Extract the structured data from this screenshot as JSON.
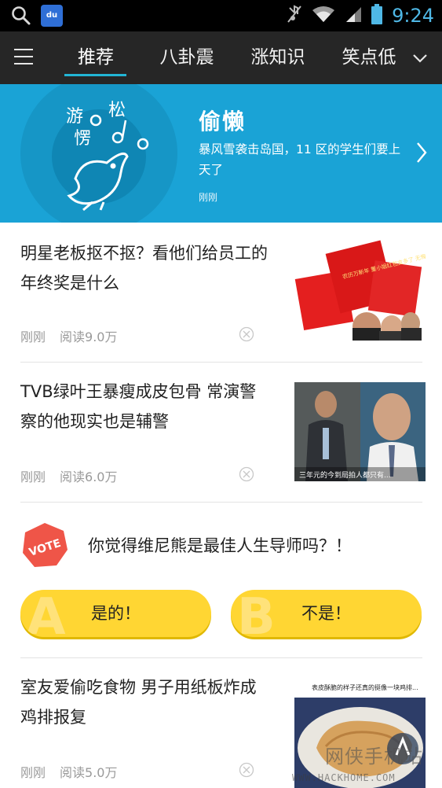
{
  "status_bar": {
    "time": "9:24",
    "icons": [
      "search-icon",
      "baidu-app-icon",
      "mute-icon",
      "wifi-icon",
      "signal-icon",
      "battery-icon"
    ],
    "baidu_label": "du"
  },
  "nav": {
    "tabs": [
      {
        "label": "推荐",
        "active": true
      },
      {
        "label": "八卦震",
        "active": false
      },
      {
        "label": "涨知识",
        "active": false
      },
      {
        "label": "笑点低",
        "active": false
      }
    ],
    "accent_color": "#22b5d5"
  },
  "banner": {
    "logo_text": "游 松 愣",
    "title": "偷懒",
    "description": "暴风雪袭击岛国，11 区的学生们要上天了",
    "time": "刚刚",
    "background_color": "#1aa3d6"
  },
  "news": [
    {
      "title": "明星老板抠不抠？看他们给员工的年终奖是什么",
      "time": "刚刚",
      "reads": "阅读9.0万",
      "thumb_text": "农历万新年 董小姐红包支多了 无悔"
    },
    {
      "title": "TVB绿叶王暴瘦成皮包骨 常演警察的他现实也是辅警",
      "time": "刚刚",
      "reads": "阅读6.0万",
      "thumb_text": "三年元的今到局拍人都只有..."
    },
    {
      "title": "室友爱偷吃食物 男子用纸板炸成鸡排报复",
      "time": "刚刚",
      "reads": "阅读5.0万",
      "thumb_text": "表皮酥脆的样子还真的挺像一块鸡排..."
    }
  ],
  "vote": {
    "badge": "VOTE",
    "question": "你觉得维尼熊是最佳人生导师吗？！",
    "options": [
      {
        "letter": "A",
        "label": "是的！"
      },
      {
        "letter": "B",
        "label": "不是！"
      }
    ],
    "button_color": "#ffd633",
    "badge_color": "#f05a4a"
  },
  "watermark": {
    "text": "网侠手机站",
    "url": "WWW.HACKHOME.COM"
  }
}
